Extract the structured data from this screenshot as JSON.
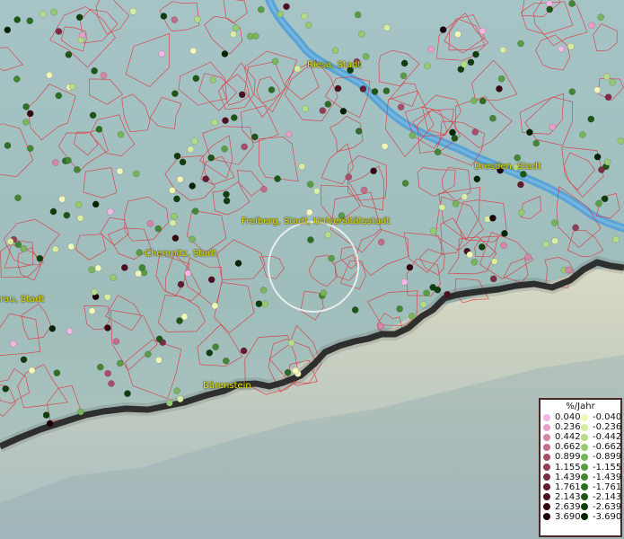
{
  "cities": [
    {
      "id": "riesa",
      "label": "Riesa, Stadt"
    },
    {
      "id": "dresden",
      "label": "Dresden, Stadt"
    },
    {
      "id": "freiberg",
      "label": "Freiberg, Stadt, Universitätsstadt"
    },
    {
      "id": "chemnitz",
      "label": "Chemnitz, Stadt"
    },
    {
      "id": "zwickau",
      "label": "rau, Stadt"
    },
    {
      "id": "baerenstein",
      "label": "Bärenstein"
    }
  ],
  "legend": {
    "title": "%/Jahr",
    "positive": [
      {
        "label": "0.040",
        "color": "#f4b6e4"
      },
      {
        "label": "0.236",
        "color": "#e6a0c8"
      },
      {
        "label": "0.442",
        "color": "#d684a8"
      },
      {
        "label": "0.662",
        "color": "#c26c8c"
      },
      {
        "label": "0.899",
        "color": "#a84e6c"
      },
      {
        "label": "1.155",
        "color": "#943e58"
      },
      {
        "label": "1.439",
        "color": "#7c2c44"
      },
      {
        "label": "1.761",
        "color": "#641c30"
      },
      {
        "label": "2.143",
        "color": "#4c1020"
      },
      {
        "label": "2.639",
        "color": "#360812"
      },
      {
        "label": "3.690",
        "color": "#1c0206"
      }
    ],
    "negative": [
      {
        "label": "-0.040",
        "color": "#f2f6b8"
      },
      {
        "label": "-0.236",
        "color": "#d8eca2"
      },
      {
        "label": "-0.442",
        "color": "#b6dc88"
      },
      {
        "label": "-0.662",
        "color": "#96ca70"
      },
      {
        "label": "-0.899",
        "color": "#78b45a"
      },
      {
        "label": "-1.155",
        "color": "#5a9c44"
      },
      {
        "label": "-1.439",
        "color": "#448634"
      },
      {
        "label": "-1.761",
        "color": "#2e6e24"
      },
      {
        "label": "-2.143",
        "color": "#1e5618"
      },
      {
        "label": "-2.639",
        "color": "#103e0e"
      },
      {
        "label": "-3.690",
        "color": "#052406"
      }
    ]
  }
}
